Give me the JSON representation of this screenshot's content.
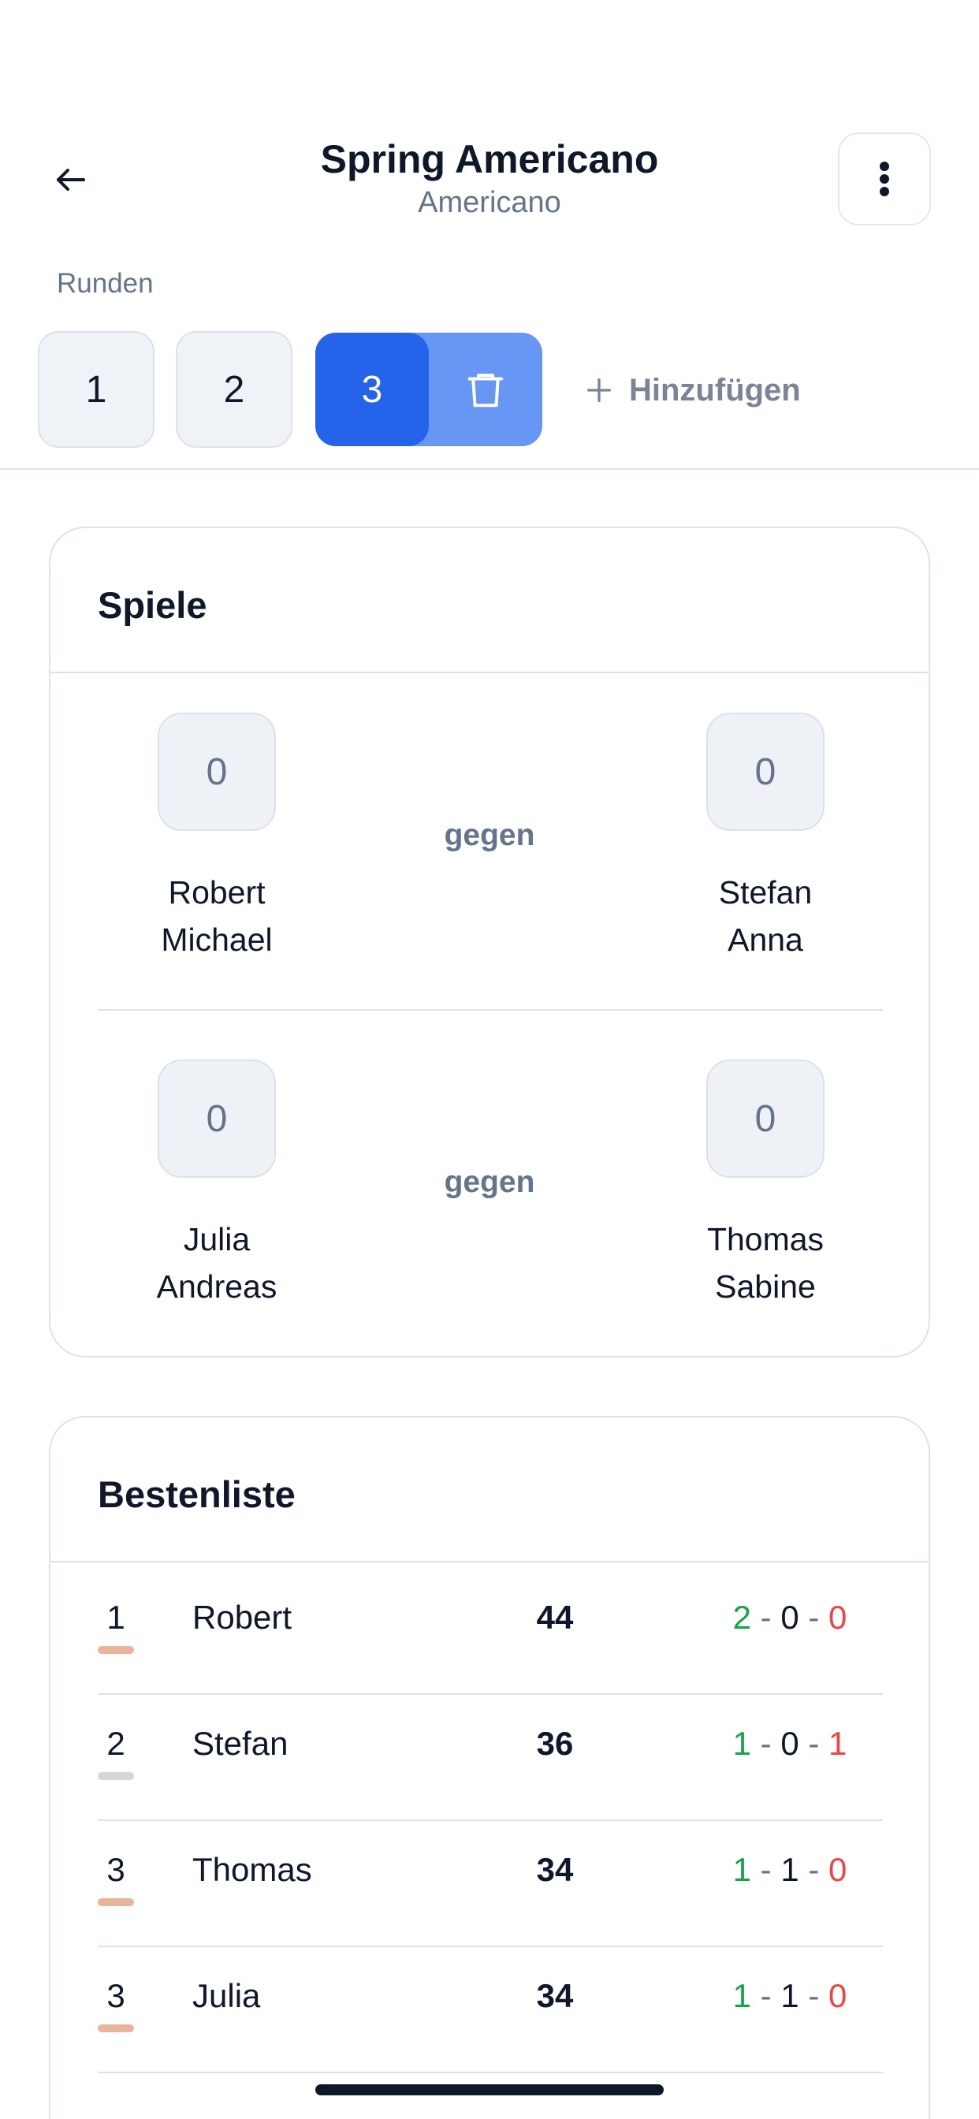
{
  "header": {
    "title": "Spring Americano",
    "subtitle": "Americano"
  },
  "rounds": {
    "label": "Runden",
    "items": [
      "1",
      "2"
    ],
    "active": "3",
    "add_label": "Hinzufügen"
  },
  "games": {
    "title": "Spiele",
    "vs_label": "gegen",
    "matches": [
      {
        "left_score": "0",
        "right_score": "0",
        "left_players": [
          "Robert",
          "Michael"
        ],
        "right_players": [
          "Stefan",
          "Anna"
        ]
      },
      {
        "left_score": "0",
        "right_score": "0",
        "left_players": [
          "Julia",
          "Andreas"
        ],
        "right_players": [
          "Thomas",
          "Sabine"
        ]
      }
    ]
  },
  "leaderboard": {
    "title": "Bestenliste",
    "rows": [
      {
        "rank": "1",
        "name": "Robert",
        "points": "44",
        "wins": "2",
        "draws": "0",
        "losses": "0",
        "medal_color": "#e8b49a"
      },
      {
        "rank": "2",
        "name": "Stefan",
        "points": "36",
        "wins": "1",
        "draws": "0",
        "losses": "1",
        "medal_color": "#d4d6da"
      },
      {
        "rank": "3",
        "name": "Thomas",
        "points": "34",
        "wins": "1",
        "draws": "1",
        "losses": "0",
        "medal_color": "#e8b49a"
      },
      {
        "rank": "3",
        "name": "Julia",
        "points": "34",
        "wins": "1",
        "draws": "1",
        "losses": "0",
        "medal_color": "#e8b49a"
      }
    ]
  },
  "colors": {
    "accent": "#2563eb",
    "accent_light": "#6796f5",
    "win": "#16a34a",
    "loss": "#ef4444"
  }
}
